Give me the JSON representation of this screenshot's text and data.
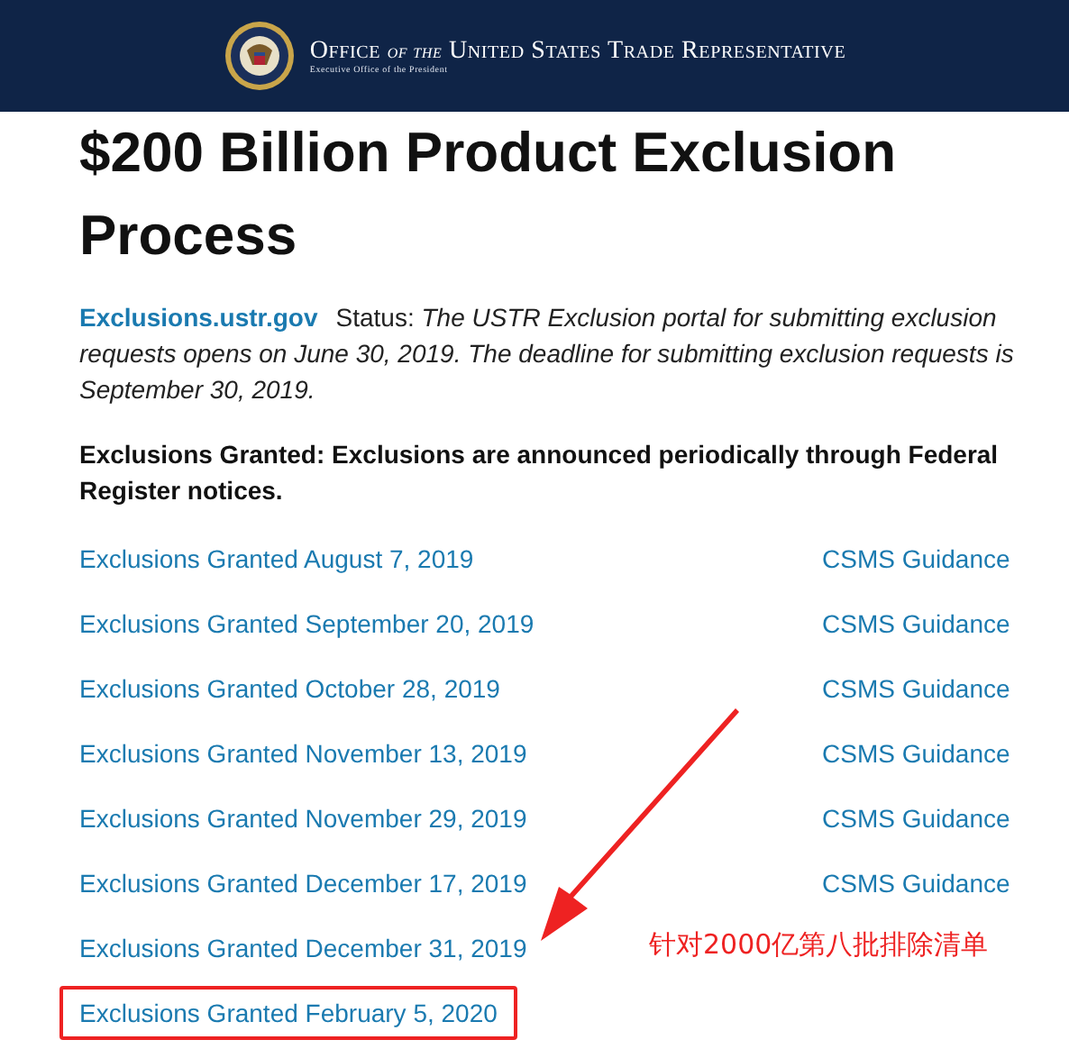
{
  "header": {
    "title_parts": [
      "Office ",
      "of the",
      " United States Trade Representative"
    ],
    "subtitle": "Executive Office of the President"
  },
  "heading": "$200 Billion Product Exclusion Process",
  "status": {
    "link": "Exclusions.ustr.gov",
    "label": "Status:",
    "text": "The USTR Exclusion portal for submitting exclusion requests opens on June 30, 2019. The deadline for submitting exclusion requests is September 30, 2019."
  },
  "notice": "Exclusions Granted: Exclusions are announced periodically through Federal Register notices.",
  "rows": [
    {
      "link": "Exclusions Granted August 7, 2019",
      "guidance": "CSMS Guidance",
      "annotated": false
    },
    {
      "link": "Exclusions Granted September 20, 2019",
      "guidance": "CSMS Guidance",
      "annotated": false
    },
    {
      "link": "Exclusions Granted October 28, 2019",
      "guidance": "CSMS Guidance",
      "annotated": false
    },
    {
      "link": "Exclusions Granted November 13, 2019",
      "guidance": "CSMS Guidance",
      "annotated": false
    },
    {
      "link": "Exclusions Granted November 29, 2019",
      "guidance": "CSMS Guidance",
      "annotated": false
    },
    {
      "link": "Exclusions Granted December 17, 2019",
      "guidance": "CSMS Guidance",
      "annotated": false
    },
    {
      "link": "Exclusions Granted December 31, 2019",
      "annotated": false
    },
    {
      "link": "Exclusions Granted February 5, 2020",
      "annotated": true
    }
  ],
  "annotation": {
    "text": "针对2000亿第八批排除清单"
  }
}
